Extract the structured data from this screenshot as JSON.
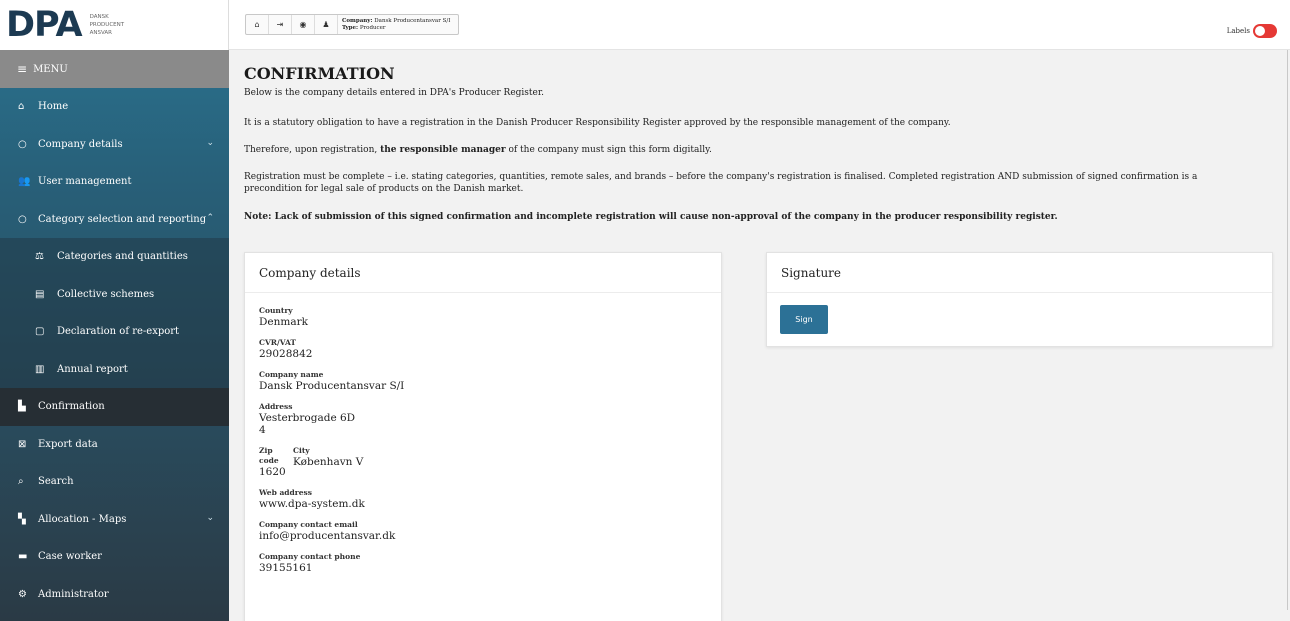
{
  "logo": {
    "text": "DPA",
    "sub_lines": [
      "DANSK",
      "PRODUCENT",
      "ANSVAR"
    ]
  },
  "sidebar": {
    "menu_label": "MENU",
    "items": [
      {
        "label": "Home",
        "icon": "home-icon"
      },
      {
        "label": "Company details",
        "icon": "circle-icon",
        "chevron": "down"
      },
      {
        "label": "User management",
        "icon": "users-icon"
      },
      {
        "label": "Category selection and reporting",
        "icon": "circle-icon",
        "chevron": "up"
      },
      {
        "label": "Categories and quantities",
        "icon": "balance-scale-icon"
      },
      {
        "label": "Collective schemes",
        "icon": "document-list-icon"
      },
      {
        "label": "Declaration of re-export",
        "icon": "document-icon"
      },
      {
        "label": "Annual report",
        "icon": "bar-chart-icon"
      },
      {
        "label": "Confirmation",
        "icon": "file-check-icon"
      },
      {
        "label": "Export data",
        "icon": "export-icon"
      },
      {
        "label": "Search",
        "icon": "search-icon"
      },
      {
        "label": "Allocation - Maps",
        "icon": "map-icon",
        "chevron": "down"
      },
      {
        "label": "Case worker",
        "icon": "database-icon"
      },
      {
        "label": "Administrator",
        "icon": "cogs-icon"
      }
    ]
  },
  "topbar": {
    "company_label": "Company:",
    "company_value": "Dansk Producentansvar S/I",
    "type_label": "Type:",
    "type_value": "Producer",
    "labels_text": "Labels",
    "labels_toggle_color": "#e53935"
  },
  "main": {
    "title": "CONFIRMATION",
    "intro": "Below is the company details entered in DPA's Producer Register.",
    "para2": "It is a statutory obligation to have a registration in the Danish Producer Responsibility Register approved by the responsible management of the company.",
    "para3_prefix": "Therefore, upon registration, ",
    "para3_bold": "the responsible manager",
    "para3_suffix": " of the company must sign this form digitally.",
    "para4": "Registration must be complete – i.e. stating categories, quantities, remote sales, and brands – before the company's registration is finalised. Completed registration AND submission of signed confirmation is a precondition for legal sale of products on the Danish market.",
    "note": "Note: Lack of submission of this signed confirmation and incomplete registration will cause non-approval of the company in the producer responsibility register."
  },
  "company_card": {
    "title": "Company details",
    "country_label": "Country",
    "country": "Denmark",
    "cvr_label": "CVR/VAT",
    "cvr": "29028842",
    "name_label": "Company name",
    "name": "Dansk Producentansvar S/I",
    "address_label": "Address",
    "address_line1": "Vesterbrogade 6D",
    "address_line2": "4",
    "zip_label": "Zip code",
    "zip": "1620",
    "city_label": "City",
    "city": "København V",
    "web_label": "Web address",
    "web": "www.dpa-system.dk",
    "email_label": "Company contact email",
    "email": "info@producentansvar.dk",
    "phone_label": "Company contact phone",
    "phone": "39155161"
  },
  "signature_card": {
    "title": "Signature",
    "sign_label": "Sign",
    "button_color": "#2c7196"
  },
  "colors": {
    "sidebar_top": "#2a7592",
    "sidebar_bottom": "#2a3a45",
    "menu_bar": "#8a8a8a",
    "active_item": "#262e34"
  }
}
